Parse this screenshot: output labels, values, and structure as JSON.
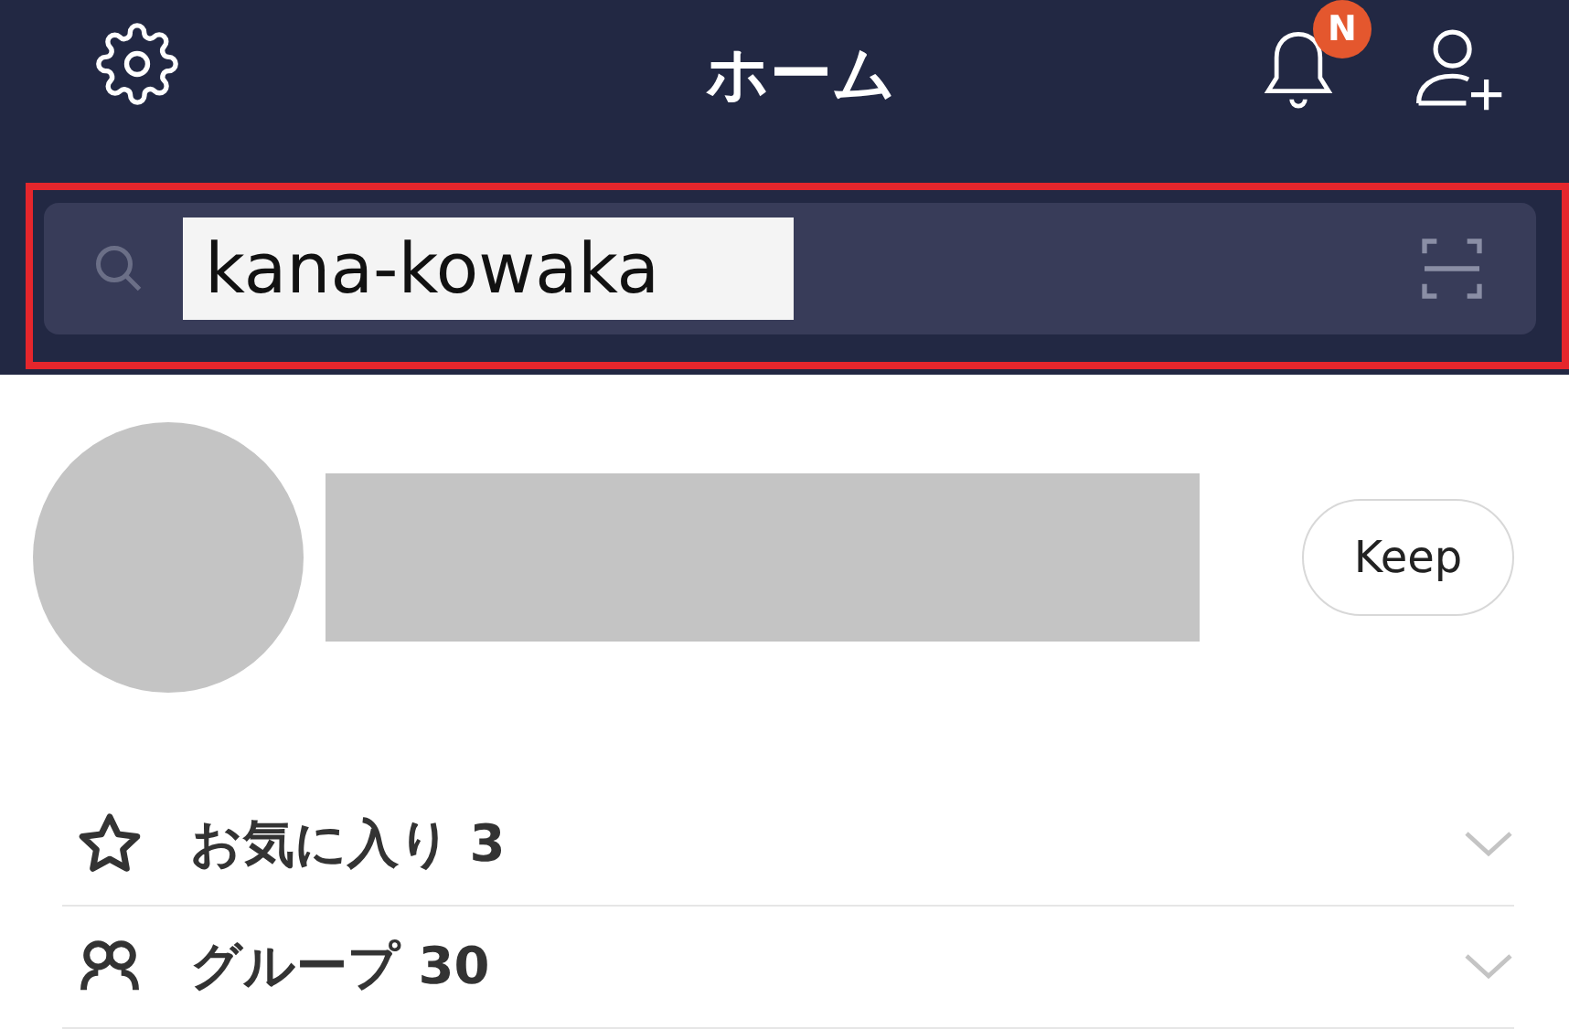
{
  "header": {
    "title": "ホーム",
    "notification_badge": "N"
  },
  "search": {
    "value": "kana-kowaka",
    "highlighted": true
  },
  "profile": {
    "keep_button": "Keep"
  },
  "sections": [
    {
      "kind": "star",
      "label": "お気に入り 3",
      "expanded": false
    },
    {
      "kind": "group",
      "label": "グループ 30",
      "expanded": false
    }
  ]
}
